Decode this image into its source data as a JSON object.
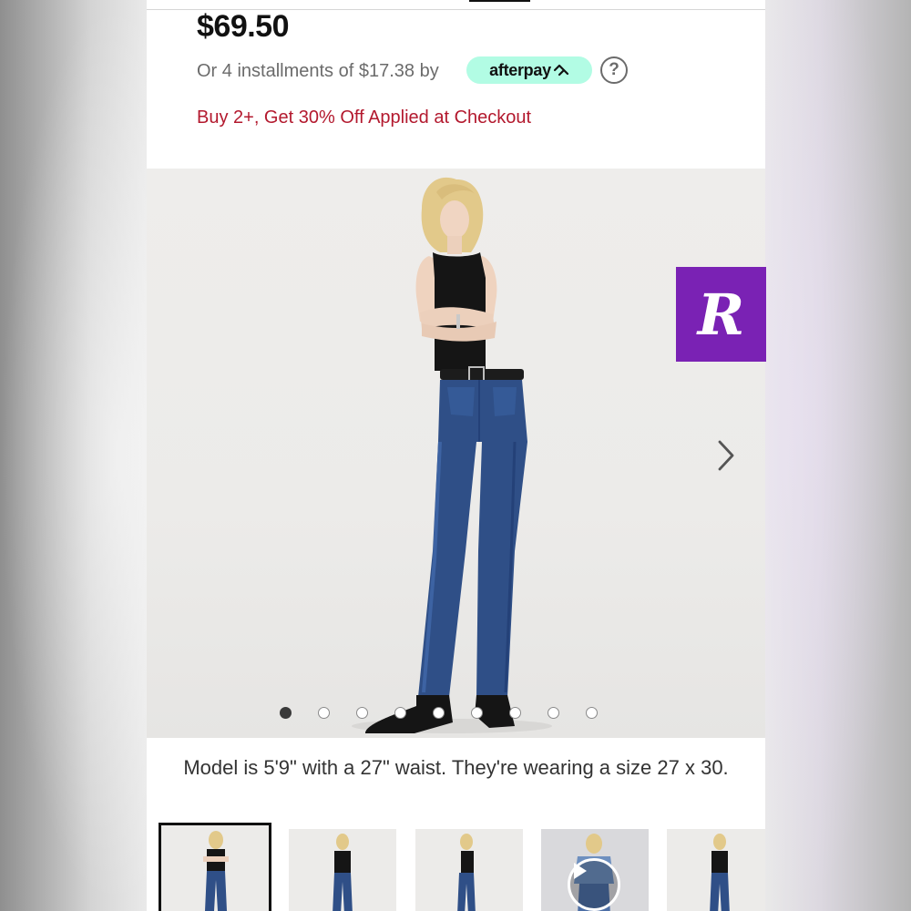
{
  "product": {
    "price": "$69.50",
    "installments_text": "Or 4 installments of $17.38 by",
    "afterpay_label": "afterpay",
    "help_symbol": "?",
    "promo_text": "Buy 2+, Get 30% Off Applied at Checkout",
    "model_caption": "Model is 5'9\" with a 27\" waist. They're wearing a size 27 x 30."
  },
  "gallery": {
    "image_count": 9,
    "active_index": 0,
    "next_icon": "chevron-right-icon"
  },
  "thumbnails": [
    {
      "type": "image",
      "selected": true
    },
    {
      "type": "image",
      "selected": false
    },
    {
      "type": "image",
      "selected": false
    },
    {
      "type": "video",
      "selected": false
    },
    {
      "type": "image",
      "selected": false
    }
  ],
  "overlay_badge": {
    "letter": "R",
    "color": "#7a22b4"
  },
  "colors": {
    "promo": "#b3192e",
    "afterpay_mint": "#b2fce4",
    "text_muted": "#6b6b6b"
  }
}
